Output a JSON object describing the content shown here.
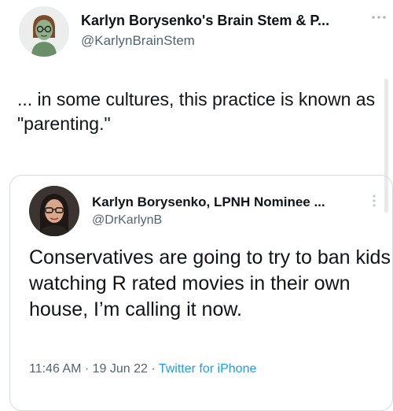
{
  "header": {
    "display_name": "Karlyn Borysenko's Brain Stem & P...",
    "handle": "@KarlynBrainStem",
    "avatar_icon": "cartoon-avatar-icon",
    "more_icon": "more-options-icon"
  },
  "tweet": {
    "text": "... in some cultures, this practice is known as \"parenting.\""
  },
  "quoted_tweet": {
    "display_name": "Karlyn Borysenko, LPNH Nominee ...",
    "handle": "@DrKarlynB",
    "text": "Conservatives are going to try to ban kids watching R rated movies in their own house, I’m calling it now.",
    "time": "11:46 AM",
    "separator": " · ",
    "date": "19 Jun 22",
    "source": "Twitter for iPhone",
    "avatar_icon": "profile-photo-icon",
    "more_icon": "more-options-icon"
  },
  "colors": {
    "text_primary": "#0f1419",
    "text_secondary": "#536471",
    "link": "#1d9bf0",
    "border": "#d6dde3"
  }
}
